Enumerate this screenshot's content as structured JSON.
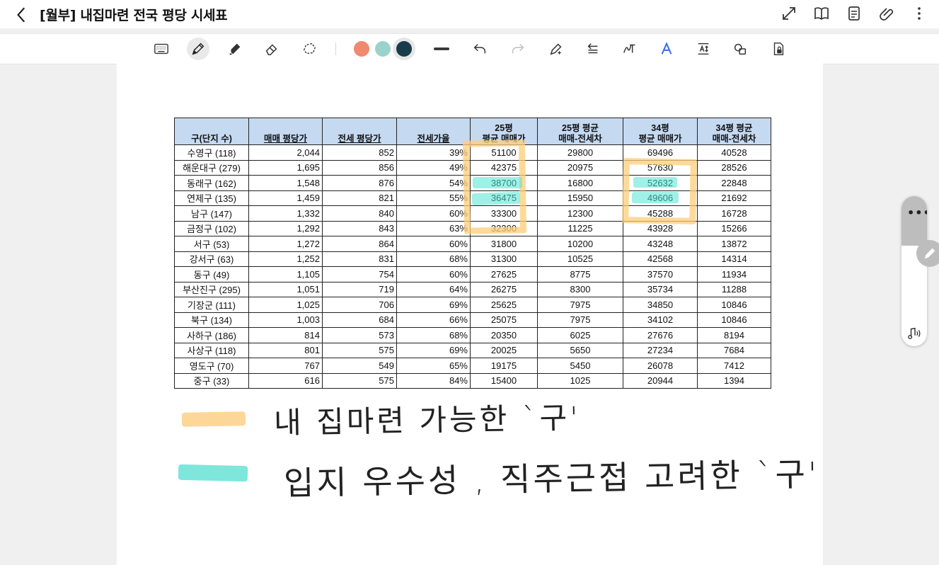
{
  "header": {
    "title": "[월부] 내집마련 전국 평당 시세표"
  },
  "icons": {
    "back": "chevron-left-icon",
    "fullscreen": "expand-icon",
    "book": "book-icon",
    "doc": "document-icon",
    "attach": "paperclip-icon",
    "more": "more-vertical-icon"
  },
  "toolbar": {
    "colors": [
      "#f08a6e",
      "#9bd3cc",
      "#183c4c"
    ]
  },
  "table": {
    "headers": [
      [
        "구(단지 수)",
        ""
      ],
      [
        "매매 평당가",
        ""
      ],
      [
        "전세 평당가",
        ""
      ],
      [
        "전세가율",
        ""
      ],
      [
        "25평",
        "평균 매매가"
      ],
      [
        "25평 평균",
        "매매-전세차"
      ],
      [
        "34평",
        "평균 매매가"
      ],
      [
        "34평 평균",
        "매매-전세차"
      ]
    ],
    "rows": [
      [
        "수영구 (118)",
        "2,044",
        "852",
        "39%",
        "51100",
        "29800",
        "69496",
        "40528"
      ],
      [
        "해운대구 (279)",
        "1,695",
        "856",
        "49%",
        "42375",
        "20975",
        "57630",
        "28526"
      ],
      [
        "동래구 (162)",
        "1,548",
        "876",
        "54%",
        "38700",
        "16800",
        "52632",
        "22848"
      ],
      [
        "연제구 (135)",
        "1,459",
        "821",
        "55%",
        "36475",
        "15950",
        "49606",
        "21692"
      ],
      [
        "남구 (147)",
        "1,332",
        "840",
        "60%",
        "33300",
        "12300",
        "45288",
        "16728"
      ],
      [
        "금정구 (102)",
        "1,292",
        "843",
        "63%",
        "32300",
        "11225",
        "43928",
        "15266"
      ],
      [
        "서구 (53)",
        "1,272",
        "864",
        "60%",
        "31800",
        "10200",
        "43248",
        "13872"
      ],
      [
        "강서구 (63)",
        "1,252",
        "831",
        "68%",
        "31300",
        "10525",
        "42568",
        "14314"
      ],
      [
        "동구 (49)",
        "1,105",
        "754",
        "60%",
        "27625",
        "8775",
        "37570",
        "11934"
      ],
      [
        "부산진구 (295)",
        "1,051",
        "719",
        "64%",
        "26275",
        "8300",
        "35734",
        "11288"
      ],
      [
        "기장군 (111)",
        "1,025",
        "706",
        "69%",
        "25625",
        "7975",
        "34850",
        "10846"
      ],
      [
        "북구 (134)",
        "1,003",
        "684",
        "66%",
        "25075",
        "7975",
        "34102",
        "10846"
      ],
      [
        "사하구 (186)",
        "814",
        "573",
        "68%",
        "20350",
        "6025",
        "27676",
        "8194"
      ],
      [
        "사상구 (118)",
        "801",
        "575",
        "69%",
        "20025",
        "5650",
        "27234",
        "7684"
      ],
      [
        "영도구 (70)",
        "767",
        "549",
        "65%",
        "19175",
        "5450",
        "26078",
        "7412"
      ],
      [
        "중구 (33)",
        "616",
        "575",
        "84%",
        "15400",
        "1025",
        "20944",
        "1394"
      ]
    ]
  },
  "notes": {
    "line1": "내 집마련 가능한 `구'",
    "line2": "입지 우수성 , 직주근접 고려한 `구'",
    "color1": "#fcd797",
    "color2": "#7fe6dc"
  }
}
